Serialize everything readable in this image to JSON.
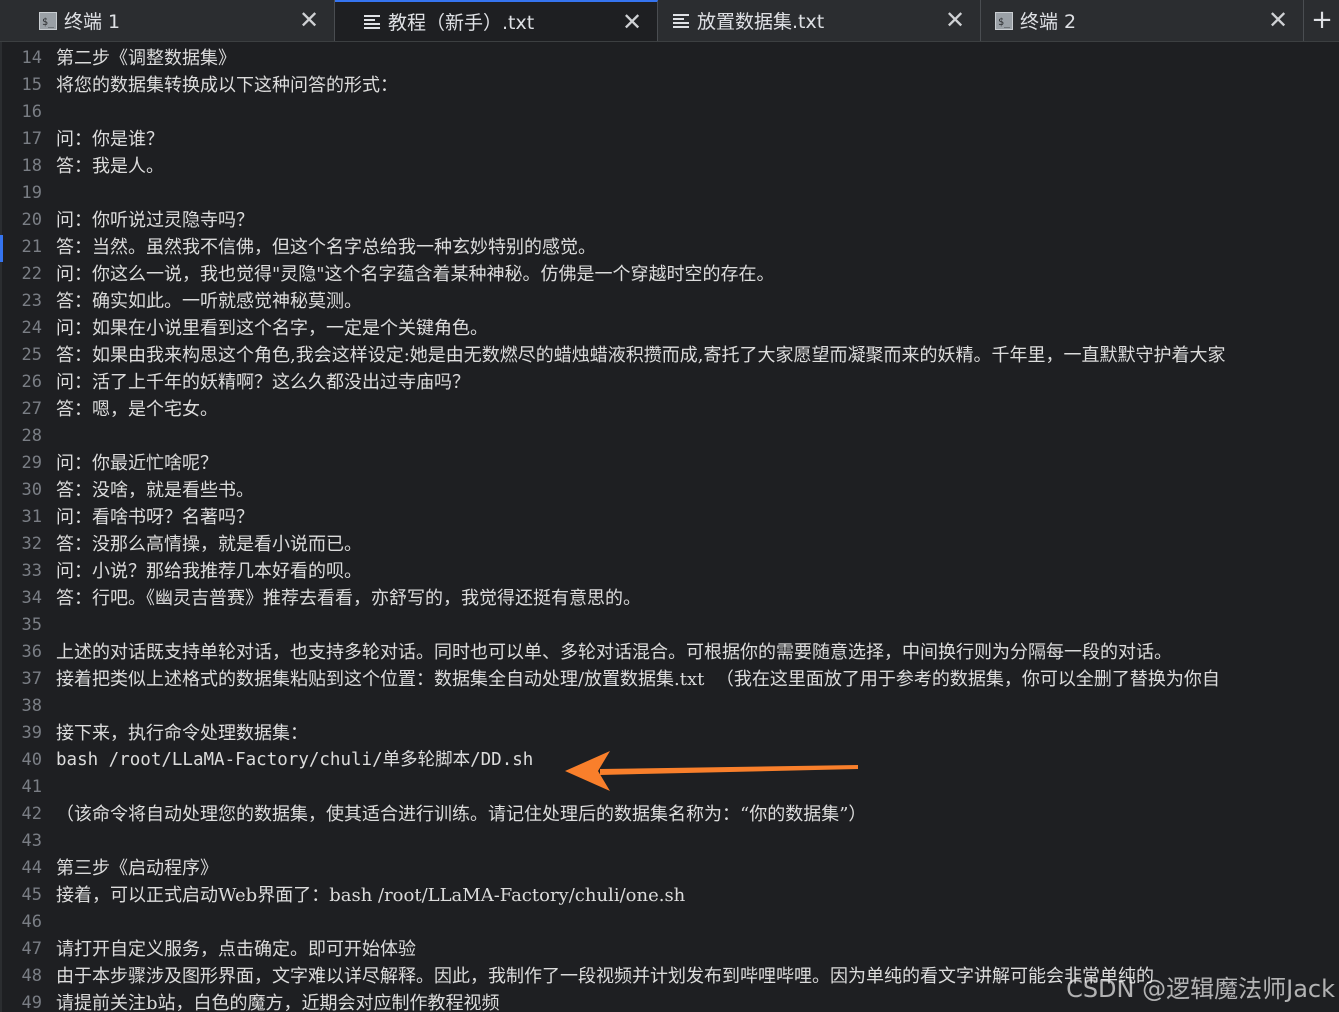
{
  "tabs": [
    {
      "label": "终端 1",
      "icon": "terminal-icon",
      "active": false
    },
    {
      "label": "教程（新手）.txt",
      "icon": "text-file-icon",
      "active": true
    },
    {
      "label": "放置数据集.txt",
      "icon": "text-file-icon",
      "active": false
    },
    {
      "label": "终端 2",
      "icon": "terminal-icon",
      "active": false
    }
  ],
  "new_tab_label": "+",
  "close_glyph": "✕",
  "lines": [
    {
      "n": "14",
      "text": "第二步《调整数据集》"
    },
    {
      "n": "15",
      "text": "将您的数据集转换成以下这种问答的形式："
    },
    {
      "n": "16",
      "text": ""
    },
    {
      "n": "17",
      "text": "问：你是谁？"
    },
    {
      "n": "18",
      "text": "答：我是人。"
    },
    {
      "n": "19",
      "text": ""
    },
    {
      "n": "20",
      "text": "问：你听说过灵隐寺吗？"
    },
    {
      "n": "21",
      "text": "答：当然。虽然我不信佛，但这个名字总给我一种玄妙特别的感觉。"
    },
    {
      "n": "22",
      "text": "问：你这么一说，我也觉得\"灵隐\"这个名字蕴含着某种神秘。仿佛是一个穿越时空的存在。"
    },
    {
      "n": "23",
      "text": "答：确实如此。一听就感觉神秘莫测。"
    },
    {
      "n": "24",
      "text": "问：如果在小说里看到这个名字，一定是个关键角色。"
    },
    {
      "n": "25",
      "text": "答：如果由我来构思这个角色,我会这样设定:她是由无数燃尽的蜡烛蜡液积攒而成,寄托了大家愿望而凝聚而来的妖精。千年里，一直默默守护着大家"
    },
    {
      "n": "26",
      "text": "问：活了上千年的妖精啊？这么久都没出过寺庙吗？"
    },
    {
      "n": "27",
      "text": "答：嗯，是个宅女。"
    },
    {
      "n": "28",
      "text": ""
    },
    {
      "n": "29",
      "text": "问：你最近忙啥呢？"
    },
    {
      "n": "30",
      "text": "答：没啥，就是看些书。"
    },
    {
      "n": "31",
      "text": "问：看啥书呀？名著吗？"
    },
    {
      "n": "32",
      "text": "答：没那么高情操，就是看小说而已。"
    },
    {
      "n": "33",
      "text": "问：小说？那给我推荐几本好看的呗。"
    },
    {
      "n": "34",
      "text": "答：行吧。《幽灵吉普赛》推荐去看看，亦舒写的，我觉得还挺有意思的。"
    },
    {
      "n": "35",
      "text": ""
    },
    {
      "n": "36",
      "text": "上述的对话既支持单轮对话，也支持多轮对话。同时也可以单、多轮对话混合。可根据你的需要随意选择，中间换行则为分隔每一段的对话。"
    },
    {
      "n": "37",
      "text": "接着把类似上述格式的数据集粘贴到这个位置：数据集全自动处理/放置数据集.txt  （我在这里面放了用于参考的数据集，你可以全删了替换为你自"
    },
    {
      "n": "38",
      "text": ""
    },
    {
      "n": "39",
      "text": "接下来，执行命令处理数据集："
    },
    {
      "n": "40",
      "text": "bash /root/LLaMA-Factory/chuli/单多轮脚本/DD.sh"
    },
    {
      "n": "41",
      "text": ""
    },
    {
      "n": "42",
      "text": "（该命令将自动处理您的数据集，使其适合进行训练。请记住处理后的数据集名称为：“你的数据集”）"
    },
    {
      "n": "43",
      "text": ""
    },
    {
      "n": "44",
      "text": "第三步《启动程序》"
    },
    {
      "n": "45",
      "text": "接着，可以正式启动Web界面了：bash /root/LLaMA-Factory/chuli/one.sh"
    },
    {
      "n": "46",
      "text": ""
    },
    {
      "n": "47",
      "text": "请打开自定义服务，点击确定。即可开始体验"
    },
    {
      "n": "48",
      "text": "由于本步骤涉及图形界面，文字难以详尽解释。因此，我制作了一段视频并计划发布到哔哩哔哩。因为单纯的看文字讲解可能会非常单纯的"
    },
    {
      "n": "49",
      "text": "请提前关注b站，白色的魔方，近期会对应制作教程视频"
    }
  ],
  "watermark": "CSDN @逻辑魔法师Jack",
  "colors": {
    "arrow": "#f97f2b",
    "accent": "#3574f0",
    "text": "#dcdcdc",
    "line_number": "#7a7e85"
  }
}
